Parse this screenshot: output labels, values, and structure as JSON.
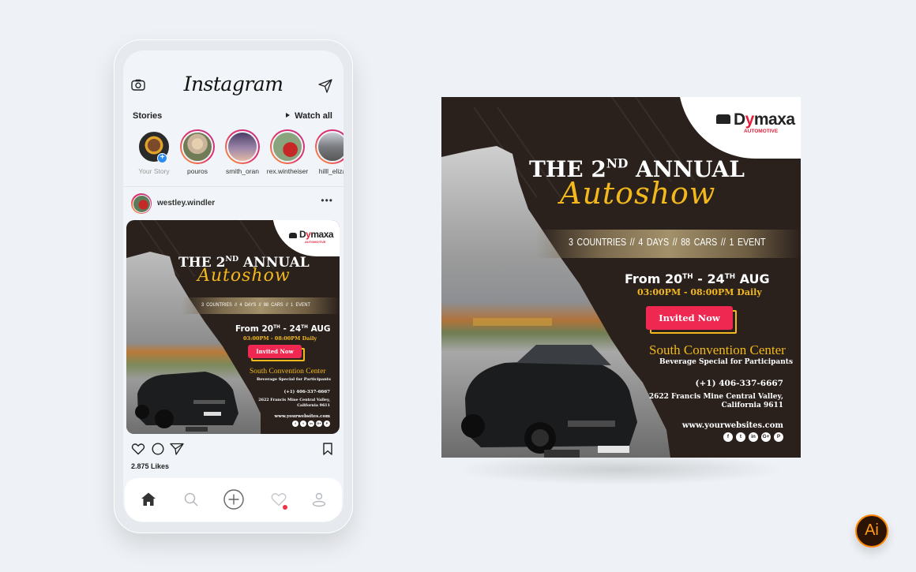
{
  "instagram": {
    "app_title": "Instagram",
    "icons": {
      "camera": "camera-icon",
      "send": "paper-plane-icon"
    },
    "stories_label": "Stories",
    "watch_all_label": "Watch all",
    "stories": [
      {
        "name": "Your Story",
        "own": true
      },
      {
        "name": "pouros"
      },
      {
        "name": "smith_oran"
      },
      {
        "name": "rex.wintheiser"
      },
      {
        "name": "hilll_eliza"
      }
    ],
    "post": {
      "username": "westley.windler",
      "more_label": "•••",
      "likes": "2.875 Likes"
    },
    "tabbar": [
      "home-icon",
      "search-icon",
      "add-icon",
      "heart-icon",
      "profile-icon"
    ],
    "notification_color": "#ef3346"
  },
  "flyer": {
    "brand": {
      "name_prefix": "D",
      "name_accent": "y",
      "name_suffix": "maxa",
      "subtitle": "AUTOMOTIVE"
    },
    "headline": {
      "prefix": "THE 2",
      "ordinal": "ND",
      "suffix": " ANNUAL"
    },
    "script_title": "Autoshow",
    "band_text": "3 COUNTRIES   //   4 DAYS   //   88 CARS   //   1 EVENT",
    "dates": {
      "from": "From 20",
      "sup1": "TH",
      "mid": " - 24",
      "sup2": "TH",
      "month": " AUG"
    },
    "time": "03:00PM - 08:00PM Daily",
    "cta_label": "Invited Now",
    "venue": "South Convention Center",
    "venue_note": "Beverage Special for Participants",
    "phone": "(+1) 406-337-6667",
    "address_line1": "2622 Francis Mine Central Valley,",
    "address_line2": "California 9611",
    "website": "www.yourwebsites.com",
    "socials": [
      {
        "icon": "facebook-icon",
        "glyph": "f"
      },
      {
        "icon": "twitter-icon",
        "glyph": "t"
      },
      {
        "icon": "linkedin-icon",
        "glyph": "in"
      },
      {
        "icon": "google-plus-icon",
        "glyph": "G+"
      },
      {
        "icon": "pinterest-icon",
        "glyph": "P"
      }
    ],
    "colors": {
      "background": "#2a211d",
      "accent_gold": "#f2b81c",
      "cta_red": "#ef2852",
      "brand_red": "#e3203a"
    }
  },
  "badge": {
    "label": "Ai",
    "icon": "adobe-illustrator-icon"
  }
}
